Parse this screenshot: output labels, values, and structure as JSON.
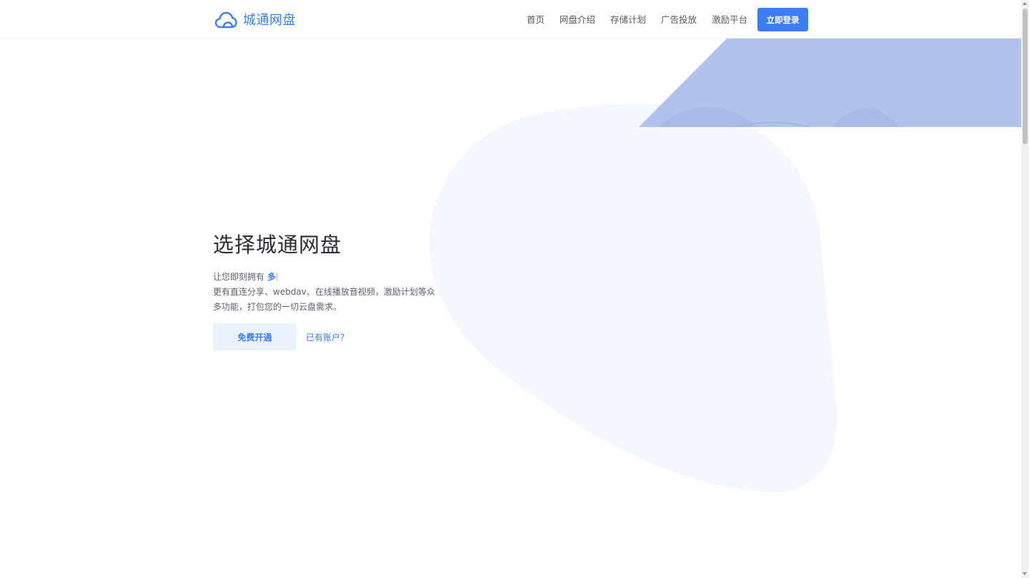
{
  "brand": {
    "name": "城通网盘",
    "icon": "cloud-icon",
    "color": "#3b7ef8"
  },
  "nav": {
    "items": [
      {
        "label": "首页"
      },
      {
        "label": "网盘介绍"
      },
      {
        "label": "存储计划"
      },
      {
        "label": "广告投放"
      },
      {
        "label": "激励平台"
      }
    ],
    "login_label": "立即登录"
  },
  "hero": {
    "title": "选择城通网盘",
    "typed_prefix": "让您即刻拥有",
    "typed_text": "多",
    "description": "更有直连分享、webdav、在线播放音视频，激励计划等众多功能，打包您的一切云盘需求。",
    "primary_button": "免费开通",
    "secondary_link": "已有账户?"
  },
  "colors": {
    "accent": "#3b7ef8",
    "accent_light": "#e9f0fe",
    "blob": "#f4f7fe",
    "banner": "#b0c3ec"
  }
}
